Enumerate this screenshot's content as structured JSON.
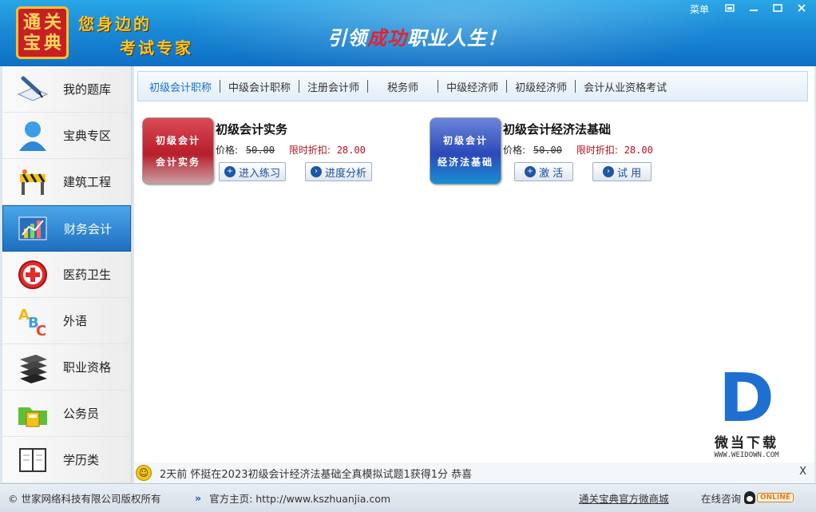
{
  "header": {
    "logo_chars": [
      "通",
      "关",
      "宝",
      "典"
    ],
    "slogan_line1": "您身边的",
    "slogan_line2": "考试专家",
    "tagline_prefix": "引领",
    "tagline_highlight": "成功",
    "tagline_suffix": "职业人生！",
    "menu_label": "菜单",
    "window_buttons": [
      "restore-small",
      "minimize",
      "maximize",
      "close"
    ]
  },
  "sidebar": {
    "items": [
      {
        "label": "我的题库",
        "icon": "pen-book-icon",
        "active": false
      },
      {
        "label": "宝典专区",
        "icon": "user-icon",
        "active": false
      },
      {
        "label": "建筑工程",
        "icon": "construction-barrier-icon",
        "active": false
      },
      {
        "label": "财务会计",
        "icon": "chart-icon",
        "active": true
      },
      {
        "label": "医药卫生",
        "icon": "medical-cross-icon",
        "active": false
      },
      {
        "label": "外语",
        "icon": "abc-icon",
        "active": false
      },
      {
        "label": "职业资格",
        "icon": "stack-icon",
        "active": false
      },
      {
        "label": "公务员",
        "icon": "folder-calculator-icon",
        "active": false
      },
      {
        "label": "学历类",
        "icon": "notebook-icon",
        "active": false
      }
    ]
  },
  "tabs": [
    "初级会计职称",
    "中级会计职称",
    "注册会计师",
    "税务师",
    "中级经济师",
    "初级经济师",
    "会计从业资格考试"
  ],
  "products": [
    {
      "cover_line1": "初级会计",
      "cover_line2": "会计实务",
      "title": "初级会计实务",
      "price_label": "价格:",
      "price_old": "50.00",
      "discount_label": "限时折扣:",
      "discount_price": "28.00",
      "buttons": [
        {
          "label": "进入练习",
          "icon": "plus-circle-icon"
        },
        {
          "label": "进度分析",
          "icon": "arrow-circle-icon"
        }
      ]
    },
    {
      "cover_line1": "初级会计",
      "cover_line2": "经济法基础",
      "title": "初级会计经济法基础",
      "price_label": "价格:",
      "price_old": "50.00",
      "discount_label": "限时折扣:",
      "discount_price": "28.00",
      "buttons": [
        {
          "label": "激 活",
          "icon": "plus-circle-icon"
        },
        {
          "label": "试 用",
          "icon": "arrow-circle-icon"
        }
      ]
    }
  ],
  "notice": {
    "text": "2天前 怀挺在2023初级会计经济法基础全真模拟试题1获得1分 恭喜",
    "close": "X"
  },
  "watermark": {
    "letter": "D",
    "cn": "微当下载",
    "url": "WWW.WEIDOWN.COM"
  },
  "footer": {
    "copyright": "© 世家网络科技有限公司版权所有",
    "homepage": "官方主页: http://www.kszhuanjia.com",
    "mall": "通关宝典官方微商城",
    "consult": "在线咨询",
    "online": "ONLINE"
  }
}
